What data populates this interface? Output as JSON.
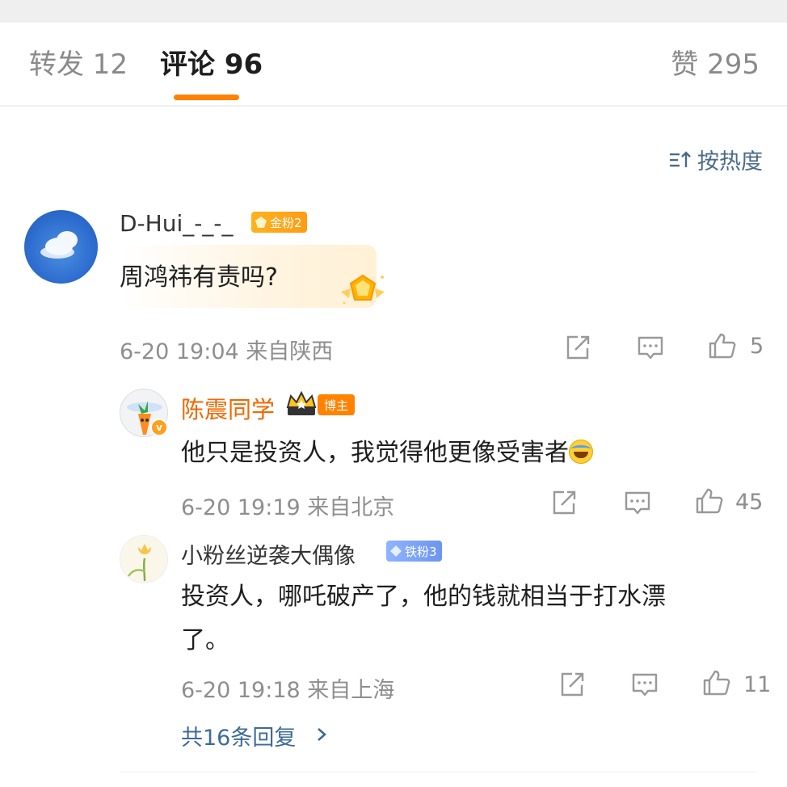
{
  "tabs": {
    "repost": "转发 12",
    "comment": "评论 96",
    "like": "赞 295",
    "active_color": "#ff8200"
  },
  "sort": {
    "label": "按热度",
    "icon": "sort-icon"
  },
  "comments": {
    "main": {
      "username": "D-Hui_-_-_",
      "badge": "金粉2",
      "text": "周鸿祎有责吗?",
      "meta": "6-20 19:04  来自陕西",
      "likes": "5"
    },
    "reply1": {
      "username": "陈震同学",
      "badge": "博主",
      "text": "他只是投资人，我觉得他更像受害者",
      "emoji": "laugh-cry-emoji",
      "meta": "6-20 19:19  来自北京",
      "likes": "45",
      "verified": "v"
    },
    "reply2": {
      "username": "小粉丝逆袭大偶像",
      "badge": "铁粉3",
      "text_line1": "投资人，哪吒破产了，他的钱就相当于打水漂",
      "text_line2": "了。",
      "meta": "6-20 19:18  来自上海",
      "likes": "11"
    }
  },
  "more_replies": "共16条回复",
  "colors": {
    "username_blogger": "#f06800",
    "link": "#3e6a98",
    "muted": "#8e8e8e"
  }
}
